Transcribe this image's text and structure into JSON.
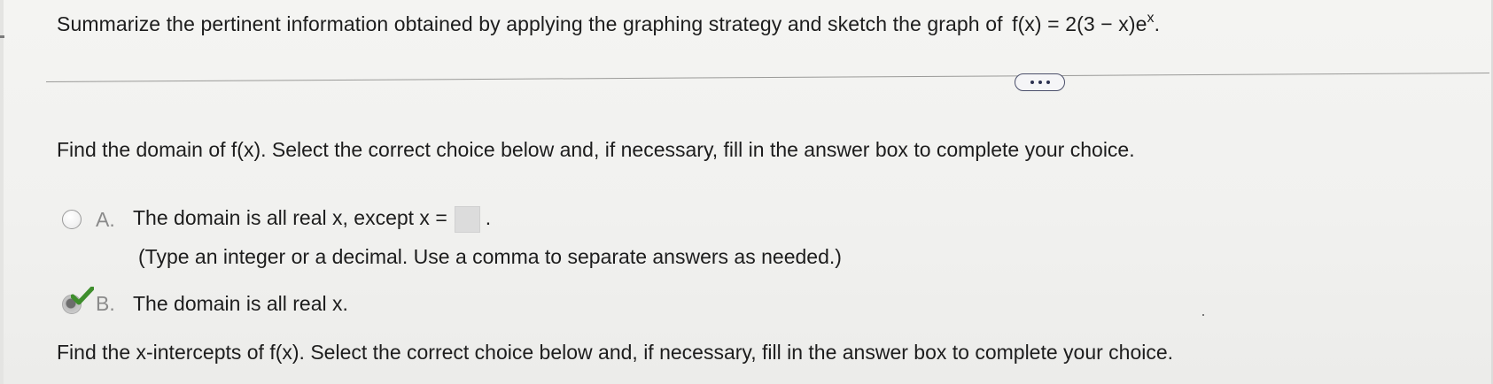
{
  "question": {
    "text": "Summarize the pertinent information obtained by applying the graphing strategy and sketch the graph of",
    "function_text": "f(x) = 2(3 − x)e",
    "exponent": "x",
    "end": "."
  },
  "more_button": {
    "icon": "ellipsis-icon"
  },
  "domain_section": {
    "prompt": "Find the domain of f(x). Select the correct choice below and, if necessary, fill in the answer box to complete your choice.",
    "choices": [
      {
        "letter": "A.",
        "text": "The domain is all real x, except x =",
        "answer_value": "",
        "suffix": ".",
        "hint": "(Type an integer or a decimal. Use a comma to separate answers as needed.)",
        "selected": false
      },
      {
        "letter": "B.",
        "text": "The domain is all real x.",
        "selected": true,
        "status_icon": "green-check-icon"
      }
    ]
  },
  "intercepts_section": {
    "prompt": "Find the x-intercepts of f(x). Select the correct choice below and, if necessary, fill in the answer box to complete your choice."
  },
  "colors": {
    "background": "#f4f4f2",
    "text": "#1d1d1d",
    "check_green": "#3e8e2c",
    "button_border": "#4a4f6a"
  }
}
